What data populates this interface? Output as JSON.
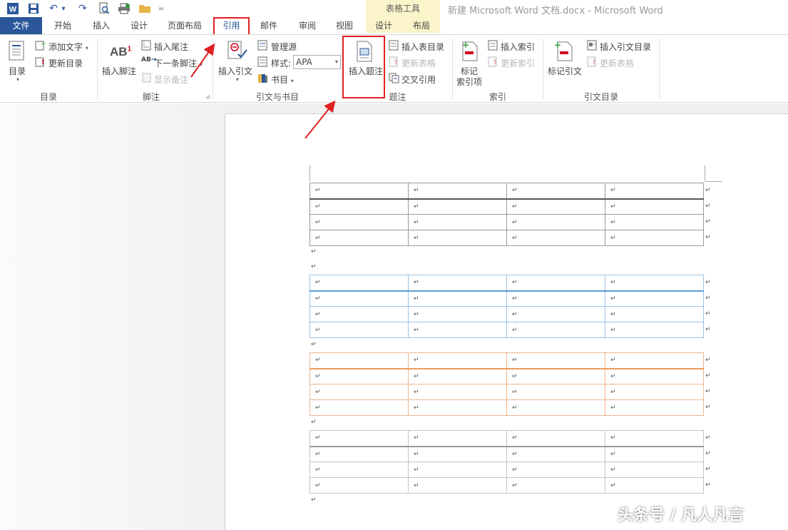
{
  "titlebar": {
    "window_title": "新建 Microsoft Word 文档.docx - Microsoft Word",
    "context_group": "表格工具",
    "quick_access": [
      {
        "icon": "word-app-icon",
        "glyph": "W"
      },
      {
        "icon": "save-icon",
        "glyph": "💾"
      },
      {
        "icon": "undo-icon",
        "glyph": "↶"
      },
      {
        "icon": "undo-dropdown-icon",
        "glyph": "▾"
      },
      {
        "icon": "redo-icon",
        "glyph": "↷"
      },
      {
        "icon": "print-preview-icon",
        "glyph": "🔍"
      },
      {
        "icon": "print-icon",
        "glyph": "🖨"
      },
      {
        "icon": "open-folder-icon",
        "glyph": "📁"
      },
      {
        "icon": "customize-toolbar-icon",
        "glyph": "="
      }
    ]
  },
  "tabs": {
    "file": "文件",
    "home": "开始",
    "insert": "插入",
    "design": "设计",
    "layout": "页面布局",
    "references": "引用",
    "mailings": "邮件",
    "review": "审阅",
    "view": "视图",
    "table_design": "设计",
    "table_layout": "布局"
  },
  "ribbon": {
    "toc": {
      "group_label": "目录",
      "toc_button": "目录",
      "add_text": "添加文字",
      "update_toc": "更新目录"
    },
    "footnotes": {
      "group_label": "脚注",
      "insert_footnote": "插入脚注",
      "footnote_glyph": "AB",
      "footnote_sup": "1",
      "insert_endnote": "插入尾注",
      "next_footnote": "下一条脚注",
      "show_notes": "显示备注"
    },
    "citations": {
      "group_label": "引文与书目",
      "insert_citation": "插入引文",
      "manage_sources": "管理源",
      "style_label": "样式:",
      "style_value": "APA",
      "bibliography": "书目"
    },
    "captions": {
      "group_label": "题注",
      "insert_caption": "插入题注",
      "insert_table_of_figures": "插入表目录",
      "update_table": "更新表格",
      "cross_reference": "交叉引用"
    },
    "index": {
      "group_label": "索引",
      "mark_entry": "标记索引项",
      "mark_entry_line1": "标记",
      "mark_entry_line2": "索引项",
      "insert_index": "插入索引",
      "update_index": "更新索引"
    },
    "toa": {
      "group_label": "引文目录",
      "mark_citation": "标记引文",
      "insert_toa": "插入引文目录",
      "update_table": "更新表格"
    }
  },
  "document": {
    "cell_mark": "↵",
    "tables": [
      {
        "rows": 4,
        "cols": 4,
        "style": "plain"
      },
      {
        "rows": 4,
        "cols": 4,
        "style": "blue"
      },
      {
        "rows": 4,
        "cols": 4,
        "style": "orange"
      },
      {
        "rows": 4,
        "cols": 4,
        "style": "grey"
      }
    ]
  },
  "annotations": {
    "highlight_color": "#e02020"
  },
  "watermark": "头条号 / 凡人凡言"
}
